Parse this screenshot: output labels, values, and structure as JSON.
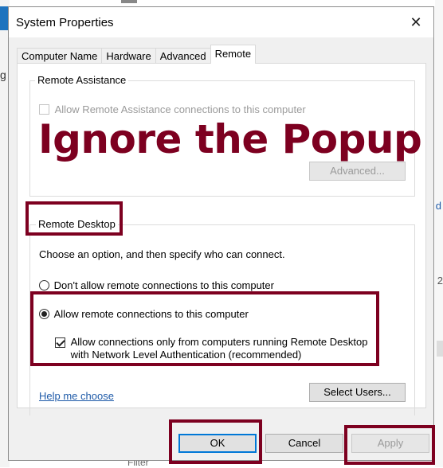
{
  "background": {
    "left_text": "g",
    "right_link": "d",
    "right_number": "2",
    "bottom_text": "Filter"
  },
  "window": {
    "title": "System Properties",
    "close_glyph": "✕"
  },
  "tabs": [
    {
      "label": "Computer Name"
    },
    {
      "label": "Hardware"
    },
    {
      "label": "Advanced"
    },
    {
      "label": "Remote",
      "active": true
    }
  ],
  "remote_assistance": {
    "group_label": "Remote Assistance",
    "checkbox_label": "Allow Remote Assistance connections to this computer",
    "checked": false,
    "advanced_button": "Advanced..."
  },
  "overlay_annotation": "Ignore the Popup",
  "remote_desktop": {
    "group_label": "Remote Desktop",
    "instructions": "Choose an option, and then specify who can connect.",
    "option_dont_allow": "Don't allow remote connections to this computer",
    "option_allow": "Allow remote connections to this computer",
    "nla_line1": "Allow connections only from computers running Remote Desktop",
    "nla_line2": "with Network Level Authentication (recommended)",
    "nla_checked": true,
    "help_link": "Help me choose",
    "select_users_button": "Select Users..."
  },
  "footer": {
    "ok": "OK",
    "cancel": "Cancel",
    "apply": "Apply"
  },
  "colors": {
    "highlight": "#7d0020",
    "link": "#1e5aa8",
    "default_button_border": "#0078d7"
  }
}
